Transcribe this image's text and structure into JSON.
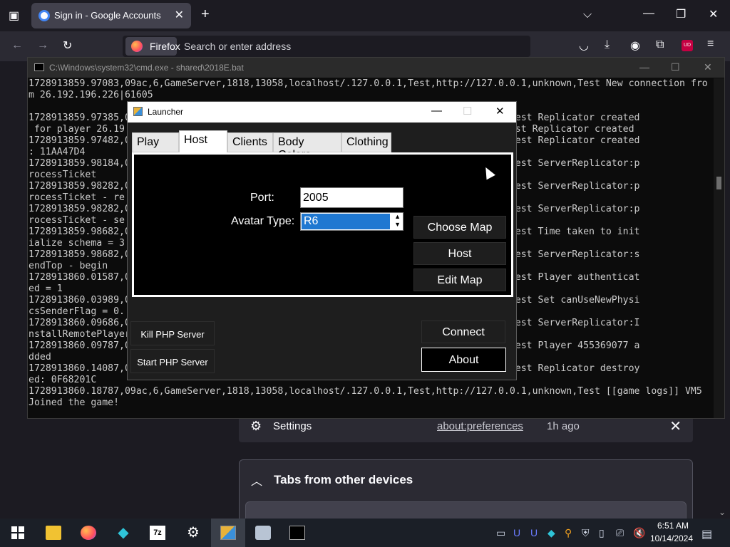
{
  "browser": {
    "tab_title": "Sign in - Google Accounts",
    "identity_label": "Firefox",
    "url_placeholder": "Search or enter address",
    "new_tab_glyph": "+",
    "tab_close_glyph": "✕",
    "ext_badge": "UD"
  },
  "newtab": {
    "recent_item": {
      "label": "Settings",
      "link": "about:preferences",
      "time": "1h ago"
    },
    "tabs_other_devices_title": "Tabs from other devices"
  },
  "cmd": {
    "title": "C:\\Windows\\system32\\cmd.exe - shared\\2018E.bat",
    "lines": [
      "1728913859.97083,09ac,6,GameServer,1818,13058,localhost/.127.0.0.1,Test,http://127.0.0.1,unknown,Test New connection fro",
      "m 26.192.196.226|61605",
      "",
      "1728913859.97385,0                                                        .1,unknown,Test Replicator created",
      " for player 26.19                                                        .1,unknown,Test Replicator created",
      "1728913859.97482,0                                                        .1,unknown,Test Replicator created",
      ": 11AA47D4",
      "1728913859.98184,0                                                        .1,unknown,Test ServerReplicator:p",
      "rocessTicket",
      "1728913859.98282,0                                                        .1,unknown,Test ServerReplicator:p",
      "rocessTicket - re",
      "1728913859.98282,0                                                        .1,unknown,Test ServerReplicator:p",
      "rocessTicket - se",
      "1728913859.98682,0                                                        .1,unknown,Test Time taken to init",
      "ialize schema = 3",
      "1728913859.98682,0                                                        .1,unknown,Test ServerReplicator:s",
      "endTop - begin",
      "1728913860.01587,0                                                        .1,unknown,Test Player authenticat",
      "ed = 1",
      "1728913860.03989,0                                                        .1,unknown,Test Set canUseNewPhysi",
      "csSenderFlag = 0.                                                        1",
      "1728913860.09686,0                                                        .1,unknown,Test ServerReplicator:I",
      "nstallRemotePlayer",
      "1728913860.09787,0                                                        .1,unknown,Test Player 455369077 a",
      "dded",
      "1728913860.14087,0                                                        .1,unknown,Test Replicator destroy",
      "ed: 0F68201C",
      "1728913860.18787,09ac,6,GameServer,1818,13058,localhost/.127.0.0.1,Test,http://127.0.0.1,unknown,Test [[game logs]] VM5",
      "Joined the game!"
    ]
  },
  "launcher": {
    "title": "Launcher",
    "tabs": [
      "Play",
      "Host",
      "Clients",
      "Body Colors",
      "Clothing"
    ],
    "active_tab": "Host",
    "port_label": "Port:",
    "port_value": "2005",
    "avatar_label": "Avatar Type:",
    "avatar_value": "R6",
    "choose_map": "Choose Map",
    "host": "Host",
    "edit_map": "Edit Map",
    "kill_php": "Kill PHP Server",
    "start_php": "Start PHP Server",
    "connect": "Connect",
    "about": "About"
  },
  "taskbar": {
    "time": "6:51 AM",
    "date": "10/14/2024",
    "apps": [
      "start-icon",
      "file-explorer-icon",
      "firefox-icon",
      "vpn-icon",
      "7zip-icon",
      "settings-icon",
      "launcher-icon",
      "remote-desktop-icon",
      "cmd-icon"
    ]
  }
}
